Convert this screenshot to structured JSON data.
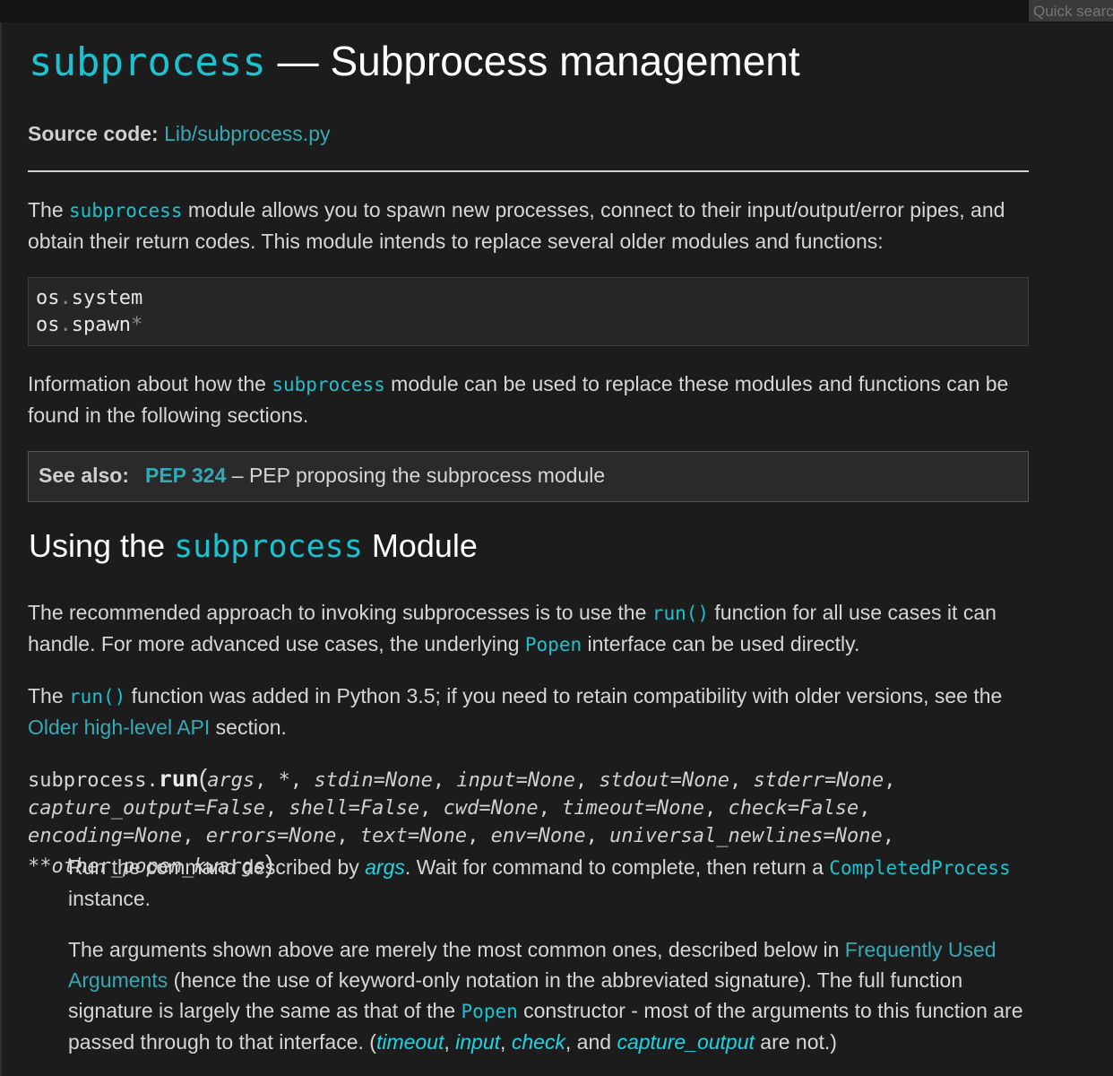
{
  "search": {
    "placeholder": "Quick search"
  },
  "title": {
    "module": "subprocess",
    "rest": " — Subprocess management"
  },
  "source": {
    "label": "Source code:",
    "link": "Lib/subprocess.py"
  },
  "intro": {
    "t1": "The ",
    "code": "subprocess",
    "t2": " module allows you to spawn new processes, connect to their input/output/error pipes, and obtain their return codes. This module intends to replace several older modules and functions:"
  },
  "code_block": {
    "line1": {
      "a": "os",
      "dot": ".",
      "b": "system"
    },
    "line2": {
      "a": "os",
      "dot": ".",
      "b": "spawn",
      "star": "*"
    }
  },
  "info": {
    "t1": "Information about how the ",
    "code": "subprocess",
    "t2": " module can be used to replace these modules and functions can be found in the following sections."
  },
  "see_also": {
    "label": "See also:",
    "pep": "PEP 324",
    "text": " – PEP proposing the subprocess module"
  },
  "section": {
    "t1": "Using the ",
    "code": "subprocess",
    "t2": " Module"
  },
  "para1": {
    "t1": "The recommended approach to invoking subprocesses is to use the ",
    "code1": "run()",
    "t2": " function for all use cases it can handle. For more advanced use cases, the underlying ",
    "code2": "Popen",
    "t3": " interface can be used directly."
  },
  "para2": {
    "t1": "The ",
    "code": "run()",
    "t2": " function was added in Python 3.5; if you need to retain compatibility with older versions, see the ",
    "link": "Older high-level API",
    "t3": " section."
  },
  "signature": {
    "prefix": "subprocess.",
    "name": "run",
    "open": "(",
    "params": [
      "args",
      "*",
      "stdin=None",
      "input=None",
      "stdout=None",
      "stderr=None",
      "capture_output=False",
      "shell=False",
      "cwd=None",
      "timeout=None",
      "check=False",
      "encoding=None",
      "errors=None",
      "text=None",
      "env=None",
      "universal_newlines=None",
      "**other_popen_kwargs"
    ],
    "close": ")"
  },
  "desc1": {
    "t1": "Run the command described by ",
    "arg": "args",
    "t2": ". Wait for command to complete, then return a ",
    "code": "CompletedProcess",
    "t3": " instance."
  },
  "desc2": {
    "t1": "The arguments shown above are merely the most common ones, described below in ",
    "link": "Frequently Used Arguments",
    "t2": " (hence the use of keyword-only notation in the abbreviated signature). The full function signature is largely the same as that of the ",
    "code": "Popen",
    "t3": " constructor - most of the arguments to this function are passed through to that interface. (",
    "a1": "timeout",
    "s1": ", ",
    "a2": "input",
    "s2": ", ",
    "a3": "check",
    "s3": ", and ",
    "a4": "capture_output",
    "t4": " are not.)"
  }
}
